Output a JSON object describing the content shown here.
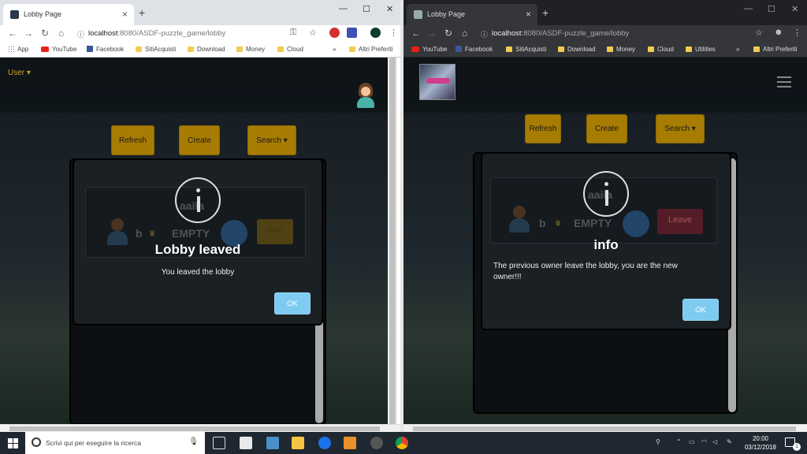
{
  "left_window": {
    "tab_title": "Lobby Page",
    "url_domain": "localhost",
    "url_path": ":8080/ASDF-puzzle_game/lobby",
    "bookmarks": [
      "App",
      "YouTube",
      "Facebook",
      "SitiAcquisti",
      "Download",
      "Money",
      "Cloud"
    ],
    "more_bookmarks": "»",
    "other_bookmarks": "Altri Preferiti",
    "user_menu": "User",
    "buttons": {
      "refresh": "Refresh",
      "create": "Create",
      "search": "Search"
    },
    "ghost_lobby": {
      "name": "aaila",
      "player": "b",
      "slot": "EMPTY",
      "action": "Join"
    },
    "modal": {
      "title": "Lobby leaved",
      "text": "You leaved the lobby",
      "ok": "OK"
    }
  },
  "right_window": {
    "tab_title": "Lobby Page",
    "url_domain": "localhost",
    "url_path": ":8080/ASDF-puzzle_game/lobby",
    "bookmarks": [
      "YouTube",
      "Facebook",
      "SitiAcquisti",
      "Download",
      "Money",
      "Cloud",
      "Utilities"
    ],
    "more_bookmarks": "»",
    "other_bookmarks": "Altri Preferiti",
    "buttons": {
      "refresh": "Refresh",
      "create": "Create",
      "search": "Search"
    },
    "ghost_lobby": {
      "name": "aaila",
      "player": "b",
      "slot": "EMPTY",
      "action": "Leave"
    },
    "modal": {
      "title": "info",
      "text": "The previous owner leave the lobby, you are the new owner!!!",
      "ok": "OK"
    }
  },
  "window_controls": {
    "minimize": "—",
    "maximize": "☐",
    "close": "✕"
  },
  "taskbar": {
    "search_placeholder": "Scrivi qui per eseguire la ricerca",
    "time": "20:00",
    "date": "03/12/2018",
    "notifications": "1"
  },
  "colors": {
    "accent_button": "#a77c03",
    "ok_button": "#7ecbf1",
    "modal_bg": "#1b2024"
  }
}
